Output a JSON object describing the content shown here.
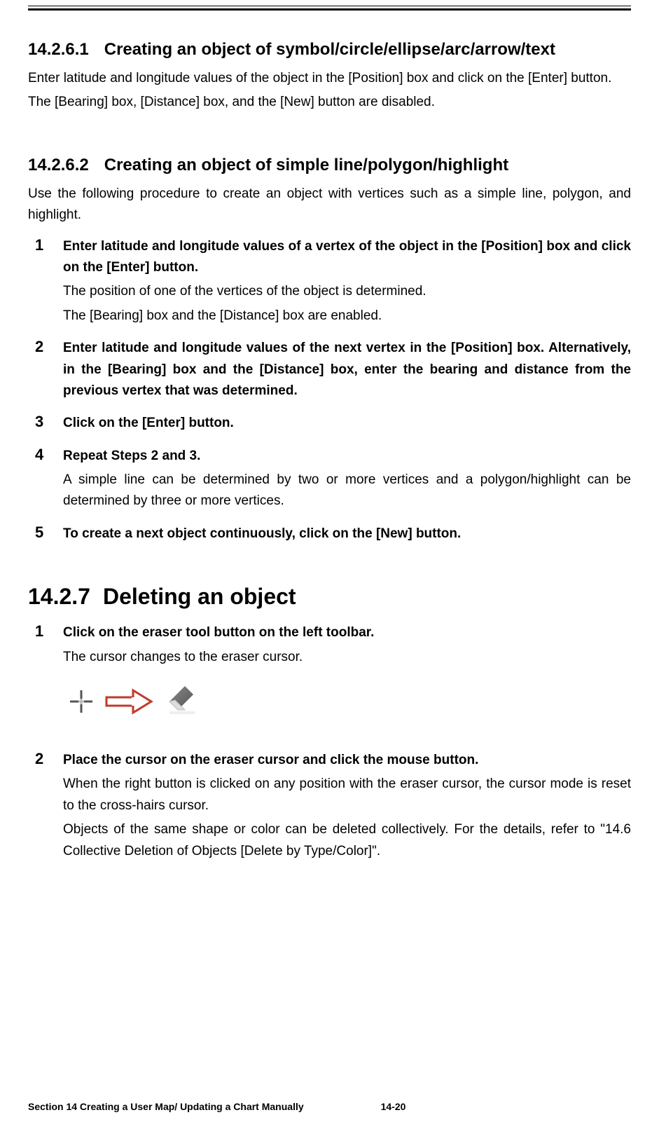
{
  "section_14_2_6_1": {
    "num": "14.2.6.1",
    "title": "Creating an object of symbol/circle/ellipse/arc/arrow/text",
    "p1": "Enter latitude and longitude values of the object in the [Position] box and click on the [Enter] button.",
    "p2": "The [Bearing] box, [Distance] box, and the [New] button are disabled."
  },
  "section_14_2_6_2": {
    "num": "14.2.6.2",
    "title": "Creating an object of simple line/polygon/highlight",
    "intro": "Use the following procedure to create an object with vertices such as a simple line, polygon, and highlight.",
    "steps": [
      {
        "n": "1",
        "title": "Enter latitude and longitude values of a vertex of the object in the [Position] box and click on the [Enter] button.",
        "desc1": "The position of one of the vertices of the object is determined.",
        "desc2": "The [Bearing] box and the [Distance] box are enabled."
      },
      {
        "n": "2",
        "title": "Enter latitude and longitude values of the next vertex in the [Position] box. Alternatively, in the [Bearing] box and the [Distance] box, enter the bearing and distance from the previous vertex that was determined."
      },
      {
        "n": "3",
        "title": "Click on the [Enter] button."
      },
      {
        "n": "4",
        "title": "Repeat Steps 2 and 3.",
        "desc1": "A simple line can be determined by two or more vertices and a polygon/highlight can be determined by three or more vertices."
      },
      {
        "n": "5",
        "title": "To create a next object continuously, click on the [New] button."
      }
    ]
  },
  "section_14_2_7": {
    "num": "14.2.7",
    "title": "Deleting an object",
    "steps": [
      {
        "n": "1",
        "title": "Click on the eraser tool button on the left toolbar.",
        "desc1": "The cursor changes to the eraser cursor."
      },
      {
        "n": "2",
        "title": "Place the cursor on the eraser cursor and click the mouse button.",
        "desc1": "When the right button is clicked on any position with the eraser cursor, the cursor mode is reset to the cross-hairs cursor.",
        "desc2": "Objects of the same shape or color can be deleted collectively. For the details, refer to \"14.6 Collective Deletion of Objects [Delete by Type/Color]\"."
      }
    ]
  },
  "footer": {
    "section": "Section 14    Creating a User Map/ Updating a Chart Manually",
    "page": "14-20"
  },
  "icons": {
    "crosshair": "crosshair-icon",
    "arrow": "arrow-right-icon",
    "eraser": "eraser-icon"
  }
}
